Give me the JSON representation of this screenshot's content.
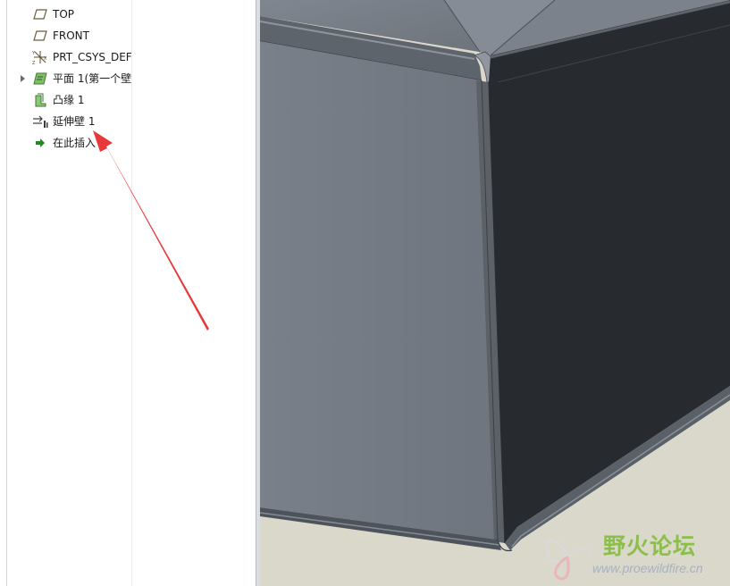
{
  "model_tree": {
    "items": [
      {
        "label": "TOP",
        "icon": "datum-plane-icon",
        "expandable": false
      },
      {
        "label": "FRONT",
        "icon": "datum-plane-icon",
        "expandable": false
      },
      {
        "label": "PRT_CSYS_DEF",
        "icon": "coordinate-system-icon",
        "expandable": false
      },
      {
        "label": "平面 1(第一个壁",
        "icon": "planar-wall-icon",
        "expandable": true
      },
      {
        "label": "凸缘 1",
        "icon": "flange-wall-icon",
        "expandable": false
      },
      {
        "label": "延伸壁 1",
        "icon": "extend-wall-icon",
        "expandable": false
      },
      {
        "label": "在此插入",
        "icon": "insert-here-arrow-icon",
        "expandable": false
      }
    ]
  },
  "watermark": {
    "title": "野火论坛",
    "url": "www.proewildfire.cn"
  },
  "colors": {
    "viewport_background": "#dad7cb",
    "model_front_face": "#757b84",
    "model_side_face": "#272b30",
    "annotation_arrow": "#e8393a",
    "watermark_green": "#8cbf4a"
  }
}
